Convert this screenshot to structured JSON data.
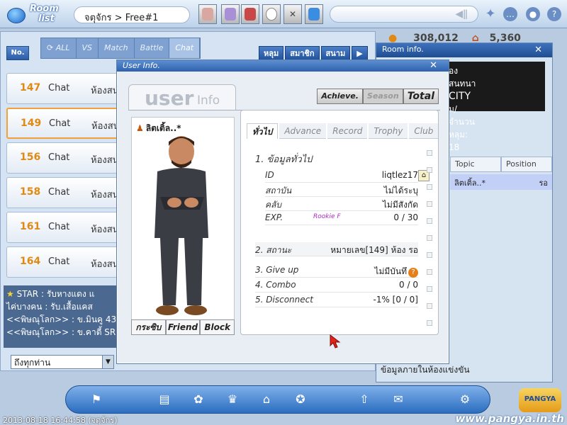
{
  "topbar": {
    "logo_line1": "Room",
    "logo_line2": "list",
    "channel": "จตุจักร > Free#1",
    "buttons": [
      "avatar-1-icon",
      "avatar-2-icon",
      "avatar-3-icon",
      "ball-icon",
      "close-x-icon",
      "caddie-icon"
    ],
    "right_icons": [
      "sparkle-icon",
      "chat-bubble-icon",
      "shield-icon",
      "help-icon"
    ]
  },
  "filter": {
    "no_label": "No.",
    "tabs": [
      "ALL",
      "VS",
      "Match",
      "Battle",
      "Chat"
    ],
    "room_tabs": [
      "หลุม",
      "สมาชิก",
      "สนาม"
    ]
  },
  "rooms": [
    {
      "num": "147",
      "type": "Chat",
      "name": "ห้องสน"
    },
    {
      "num": "149",
      "type": "Chat",
      "name": "ห้องสน"
    },
    {
      "num": "156",
      "type": "Chat",
      "name": "ห้องสน"
    },
    {
      "num": "158",
      "type": "Chat",
      "name": "ห้องสน"
    },
    {
      "num": "161",
      "type": "Chat",
      "name": "ห้องสน"
    },
    {
      "num": "164",
      "type": "Chat",
      "name": "ห้องสน"
    }
  ],
  "chat": {
    "lines": [
      "STAR : รับหางแดง แ",
      "ไค่บางคน : รับ.เสื้อแคส",
      "<<พิษณุโลก>> : ข.มินคู 430",
      "<<พิษณุโลก>> : ข.คาตี้ SR"
    ],
    "target": "ถึงทุกท่าน"
  },
  "money": {
    "a": "308,012",
    "b": "5,360"
  },
  "room_info": {
    "title": "Room info.",
    "line1": "องสนทนา",
    "line2": "CITY",
    "line3": "ม/จำนวนหลุม: 18 หลุม",
    "col_topic": "Topic",
    "col_position": "Position",
    "row_name": "ลิตเติ้ล..*",
    "row_position": "รอ",
    "footer": "ข้อมูลภายในห้องแข่งขัน"
  },
  "dialog": {
    "title": "User Info.",
    "banner_big": "user",
    "banner_small": "Info",
    "top_tabs": [
      "Achieve.",
      "Season",
      "Total"
    ],
    "char_name": "ลิตเติ้ล..*",
    "char_buttons": [
      "กระซิบ",
      "Friend",
      "Block"
    ],
    "detail_tabs": [
      "ทั่วไป",
      "Advance",
      "Record",
      "Trophy",
      "Club"
    ],
    "section1": "1. ข้อมูลทั่วไป",
    "id_label": "ID",
    "id_value": "liqtlez17",
    "status_label": "สถาบัน",
    "status_value": "ไม่ได้ระบุ",
    "club_label": "คลับ",
    "club_value": "ไม่มีสังกัด",
    "exp_label": "EXP.",
    "exp_rank": "Rookie F",
    "exp_value": "0 / 30",
    "section2": "2. สถานะ",
    "section2_value": "หมายเลข[149] ห้อง รอ",
    "giveup_label": "3. Give up",
    "giveup_value": "ไม่มีบันทึ",
    "combo_label": "4. Combo",
    "combo_value": "0 / 0",
    "disconnect_label": "5. Disconnect",
    "disconnect_value": "-1% [0 / 0]"
  },
  "bottom": {
    "timestamp": "2013-08-18 16:44:58 (จตุจักร)",
    "url": "www.pangya.in.th",
    "brand": "PANGYA",
    "dock_icons": [
      "flag-icon",
      "shop-icon",
      "gift-icon",
      "trophy-icon",
      "house-icon",
      "scratch-icon",
      "home-arrow-icon",
      "mailbox-icon",
      "settings-icon"
    ]
  },
  "colors": {
    "accent": "#2f62ae",
    "room_num": "#e08a14",
    "selected_border": "#f0a13a"
  }
}
